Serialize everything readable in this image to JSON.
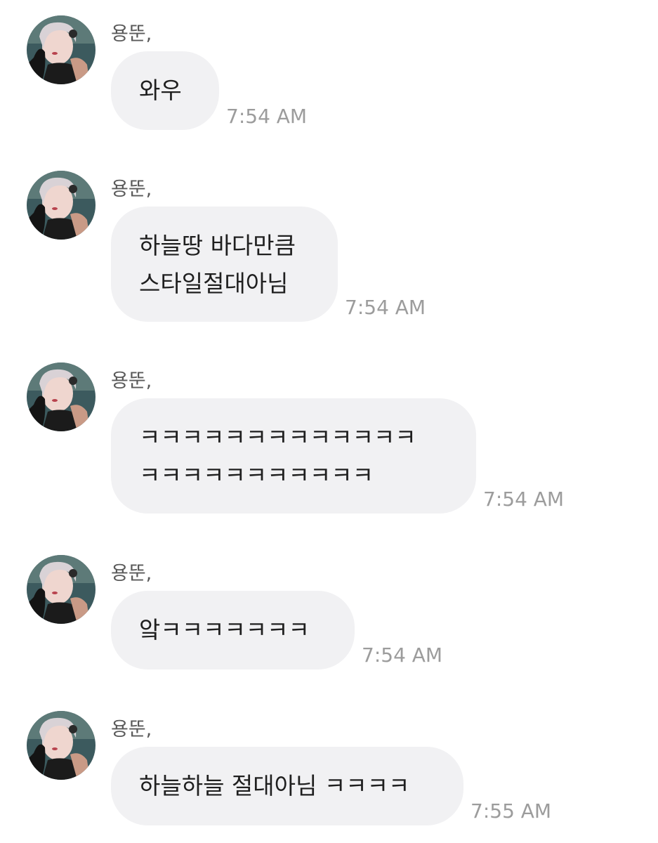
{
  "messages": [
    {
      "sender": "용뚠,",
      "lines": [
        "와우"
      ],
      "time": "7:54 AM"
    },
    {
      "sender": "용뚠,",
      "lines": [
        "하늘땅 바다만큼",
        "스타일절대아님"
      ],
      "time": "7:54 AM"
    },
    {
      "sender": "용뚠,",
      "lines": [
        "ㅋㅋㅋㅋㅋㅋㅋㅋㅋㅋㅋㅋㅋ",
        "ㅋㅋㅋㅋㅋㅋㅋㅋㅋㅋㅋ"
      ],
      "time": "7:54 AM"
    },
    {
      "sender": "용뚠,",
      "lines": [
        "앜ㅋㅋㅋㅋㅋㅋㅋ"
      ],
      "time": "7:54 AM"
    },
    {
      "sender": "용뚠,",
      "lines": [
        "하늘하늘 절대아님 ㅋㅋㅋㅋ"
      ],
      "time": "7:55 AM"
    }
  ],
  "avatar_icon": "profile-photo-avatar"
}
